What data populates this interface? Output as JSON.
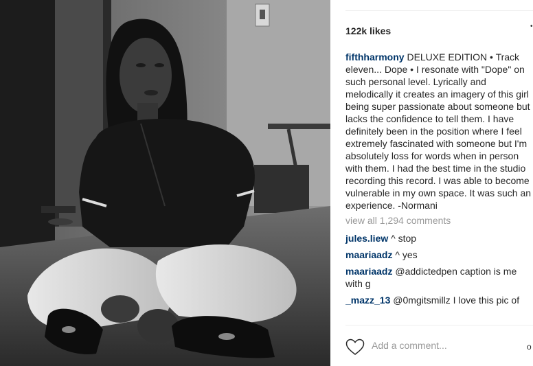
{
  "post": {
    "likes": "122k likes",
    "caption_user": "fifthharmony",
    "caption_text": " DELUXE EDITION • Track eleven... Dope • I resonate with \"Dope\" on such personal level. Lyrically and melodically it creates an imagery of this girl being super passionate about someone but lacks the confidence to tell them. I have definitely been in the position where I feel extremely fascinated with someone but I'm absolutely loss for words when in person with them. I had the best time in the studio recording this record. I was able to become vulnerable in my own space. It was such an experience. -Normani",
    "view_all": "view all 1,294 comments"
  },
  "comments": [
    {
      "user": "jules.liew",
      "text": " ^ stop"
    },
    {
      "user": "maariaadz",
      "text": " ^ yes"
    },
    {
      "user": "maariaadz",
      "text": " @addictedpen caption is me with g"
    },
    {
      "user": "_mazz_13",
      "text": " @0mgitsmillz I love this pic of"
    }
  ],
  "actions": {
    "add_comment_placeholder": "Add a comment...",
    "more_glyph": "o"
  },
  "colors": {
    "username": "#003569",
    "text": "#262626",
    "muted": "#999999"
  }
}
